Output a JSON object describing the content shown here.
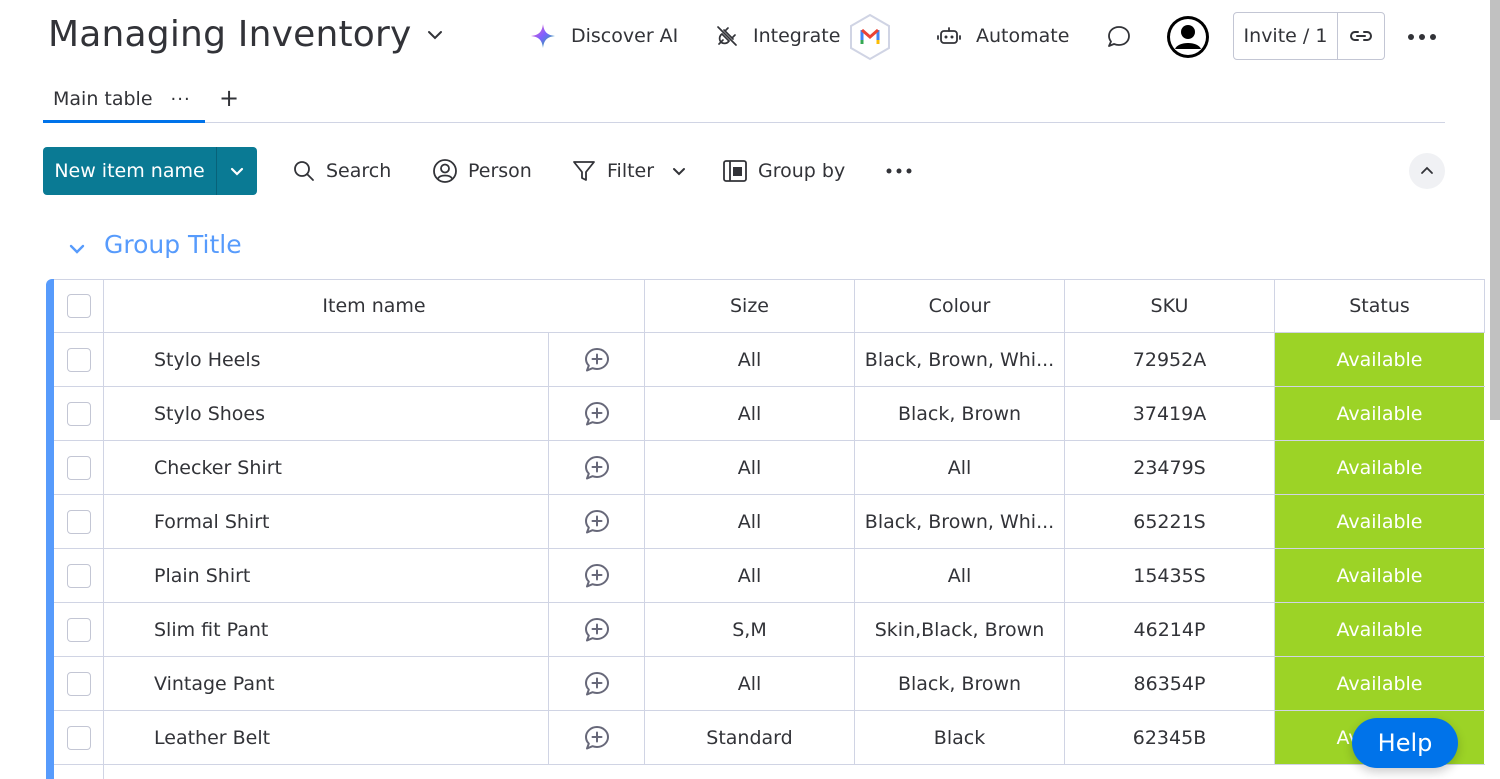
{
  "header": {
    "title": "Managing Inventory",
    "discover_ai": "Discover AI",
    "integrate": "Integrate",
    "automate": "Automate",
    "invite": "Invite / 1"
  },
  "tabs": {
    "main_label": "Main table",
    "dots": "···",
    "add": "+"
  },
  "toolbar": {
    "new_item": "New item name",
    "search": "Search",
    "person": "Person",
    "filter": "Filter",
    "group_by": "Group by"
  },
  "group": {
    "title": "Group Title",
    "color": "#579bfc"
  },
  "table": {
    "columns": [
      "Item name",
      "Size",
      "Colour",
      "SKU",
      "Status"
    ],
    "rows": [
      {
        "name": "Stylo Heels",
        "size": "All",
        "colour": "Black, Brown, Whi...",
        "sku": "72952A",
        "status": "Available"
      },
      {
        "name": "Stylo Shoes",
        "size": "All",
        "colour": "Black, Brown",
        "sku": "37419A",
        "status": "Available"
      },
      {
        "name": "Checker Shirt",
        "size": "All",
        "colour": "All",
        "sku": "23479S",
        "status": "Available"
      },
      {
        "name": "Formal Shirt",
        "size": "All",
        "colour": "Black, Brown, Whi...",
        "sku": "65221S",
        "status": "Available"
      },
      {
        "name": "Plain Shirt",
        "size": "All",
        "colour": "All",
        "sku": "15435S",
        "status": "Available"
      },
      {
        "name": "Slim fit Pant",
        "size": "S,M",
        "colour": "Skin,Black, Brown",
        "sku": "46214P",
        "status": "Available"
      },
      {
        "name": "Vintage Pant",
        "size": "All",
        "colour": "Black, Brown",
        "sku": "86354P",
        "status": "Available"
      },
      {
        "name": "Leather Belt",
        "size": "Standard",
        "colour": "Black",
        "sku": "62345B",
        "status": "Available"
      }
    ]
  },
  "help": "Help",
  "colors": {
    "accent": "#0073ea",
    "primary_button": "#0a7a94",
    "status_available": "#9cd326"
  }
}
